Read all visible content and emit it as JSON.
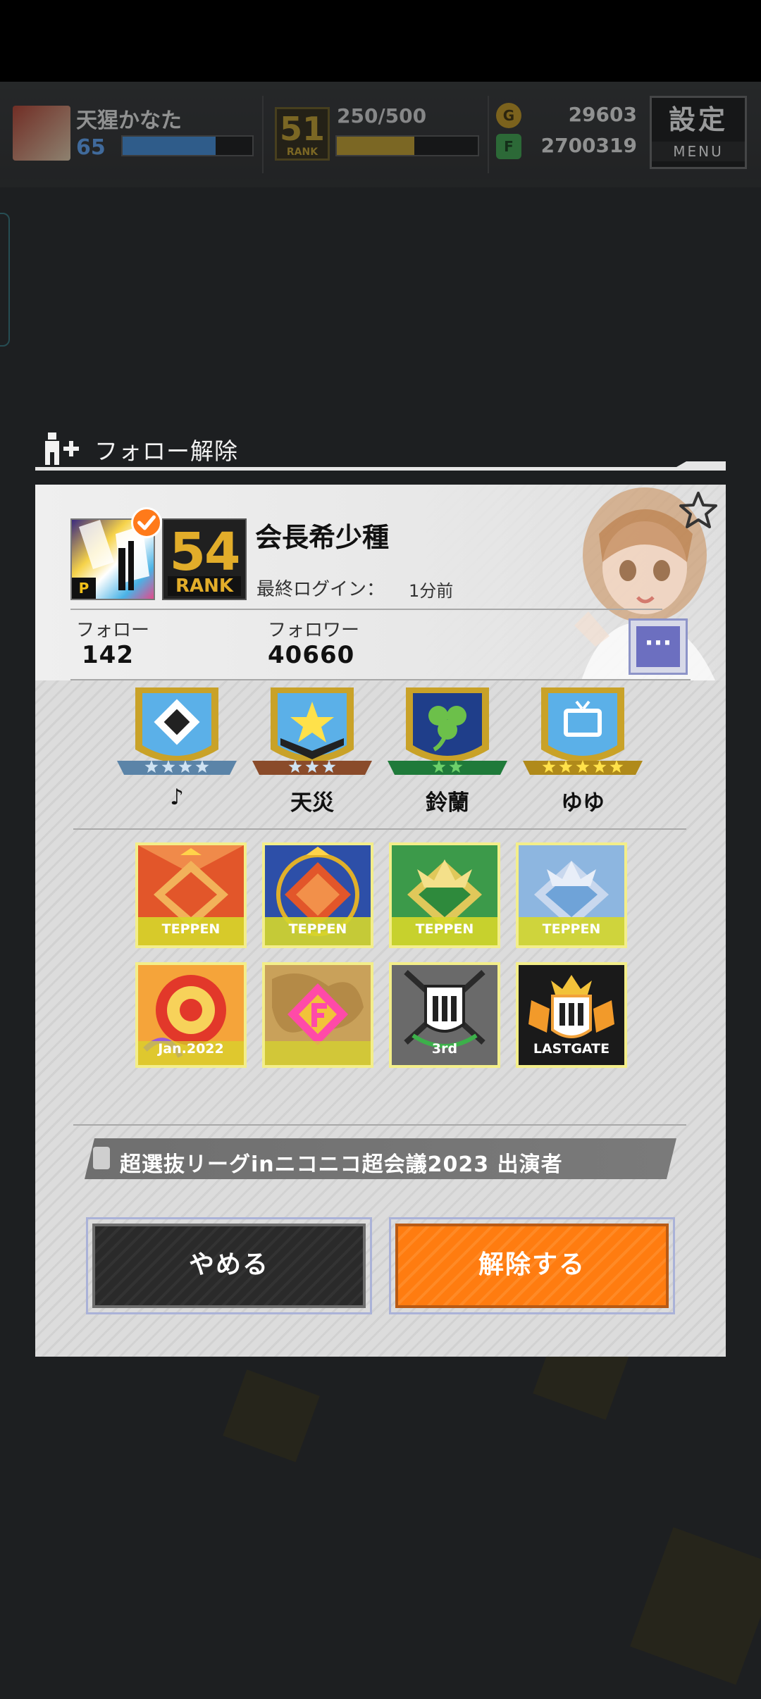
{
  "hud": {
    "player_name": "天猩かなた",
    "player_level": "65",
    "xp_fraction": 0.72,
    "rank_number": "51",
    "rank_label": "RANK",
    "stamina_text": "250/500",
    "stamina_fraction": 0.55,
    "gold": "29603",
    "green_points": "2700319",
    "menu_kanji": "設定",
    "menu_label": "MENU"
  },
  "dialog": {
    "title": "フォロー解除"
  },
  "profile": {
    "name": "会長希少種",
    "rank_number": "54",
    "rank_label": "RANK",
    "avatar_tag": "P",
    "last_login_label": "最終ログイン：",
    "last_login_value": "1分前",
    "follow_label": "フォロー",
    "follow_count": "142",
    "follower_label": "フォロワー",
    "follower_count": "40660",
    "more_label": "···"
  },
  "leagues": [
    {
      "name": "♪",
      "stars": 4,
      "ribbon_color": "#5b84a8"
    },
    {
      "name": "天災",
      "stars": 3,
      "ribbon_color": "#8a4b2a"
    },
    {
      "name": "鈴蘭",
      "stars": 2,
      "ribbon_color": "#1f7a3a"
    },
    {
      "name": "ゆゆ",
      "stars": 5,
      "ribbon_color": "#b08a1a"
    }
  ],
  "medals": [
    {
      "caption": "TEPPEN",
      "color": "#e2562a"
    },
    {
      "caption": "TEPPEN",
      "color": "#2d4fa8"
    },
    {
      "caption": "TEPPEN",
      "color": "#3c9a4a"
    },
    {
      "caption": "TEPPEN",
      "color": "#6fa3d8"
    },
    {
      "caption": "Jan.2022",
      "color": "#f08a2a"
    },
    {
      "caption": "",
      "color": "#c9a15a"
    },
    {
      "caption": "3rd",
      "color": "#2a2a2a"
    },
    {
      "caption": "LASTGATE",
      "color": "#1a1a1a"
    }
  ],
  "title_badge": "超選抜リーグinニコニコ超会議2023 出演者",
  "buttons": {
    "cancel": "やめる",
    "confirm": "解除する"
  }
}
